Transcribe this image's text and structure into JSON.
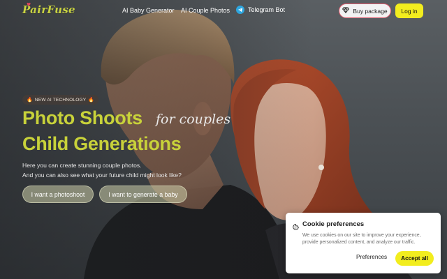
{
  "brand": {
    "logo_text": "PairFuse"
  },
  "nav": {
    "baby_generator": "AI Baby Generator",
    "couple_photos": "AI Couple Photos",
    "telegram_bot": "Telegram Bot"
  },
  "header_actions": {
    "buy_package": "Buy package",
    "login": "Log in"
  },
  "hero": {
    "badge": "NEW AI TECHNOLOGY",
    "title_line_1": "Photo Shoots",
    "title_script": "for couples",
    "title_line_2": "Child Generations",
    "description_line_1": "Here you can create stunning couple photos.",
    "description_line_2": "And you can also see what your future child might look like?",
    "cta_photoshoot": "I want a photoshoot",
    "cta_baby": "I want to generate a baby"
  },
  "cookie": {
    "title": "Cookie preferences",
    "text_line_1": "We use cookies on our site to improve your experience,",
    "text_line_2": "provide personalized content, and analyze our traffic.",
    "preferences": "Preferences",
    "accept_all": "Accept all"
  },
  "colors": {
    "accent_yellow": "#f2ed1e",
    "title_green": "#c8d23a",
    "buy_border": "#e25b6e",
    "telegram_blue": "#2ea6df"
  },
  "icons": {
    "badge": "fire-icon",
    "buy": "diamond-icon",
    "telegram": "telegram-icon",
    "cookie": "cookie-icon"
  }
}
